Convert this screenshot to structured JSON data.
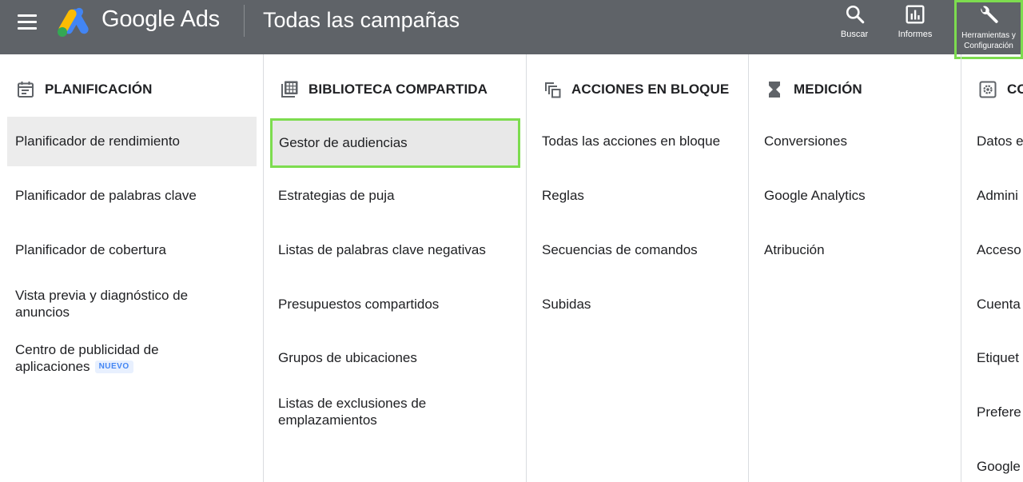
{
  "header": {
    "brand": "Google Ads",
    "page_title": "Todas las campañas",
    "tools": [
      {
        "label": "Buscar",
        "icon": "search-icon"
      },
      {
        "label": "Informes",
        "icon": "reports-icon"
      },
      {
        "label": "Herramientas y Configuración",
        "icon": "wrench-icon",
        "highlighted": true
      }
    ]
  },
  "columns": [
    {
      "title": "PLANIFICACIÓN",
      "icon": "calendar-icon",
      "items": [
        {
          "label": "Planificador de rendimiento",
          "selected": true
        },
        {
          "label": "Planificador de palabras clave"
        },
        {
          "label": "Planificador de cobertura"
        },
        {
          "label": "Vista previa y diagnóstico de anuncios"
        },
        {
          "label": "Centro de publicidad de aplicaciones",
          "badge": "NUEVO"
        }
      ]
    },
    {
      "title": "BIBLIOTECA COMPARTIDA",
      "icon": "library-grid-icon",
      "items": [
        {
          "label": "Gestor de audiencias",
          "highlighted": true
        },
        {
          "label": "Estrategias de puja"
        },
        {
          "label": "Listas de palabras clave negativas"
        },
        {
          "label": "Presupuestos compartidos"
        },
        {
          "label": "Grupos de ubicaciones"
        },
        {
          "label": "Listas de exclusiones de emplazamientos"
        }
      ]
    },
    {
      "title": "ACCIONES EN BLOQUE",
      "icon": "copy-stack-icon",
      "items": [
        {
          "label": "Todas las acciones en bloque"
        },
        {
          "label": "Reglas"
        },
        {
          "label": "Secuencias de comandos"
        },
        {
          "label": "Subidas"
        }
      ]
    },
    {
      "title": "MEDICIÓN",
      "icon": "hourglass-icon",
      "items": [
        {
          "label": "Conversiones"
        },
        {
          "label": "Google Analytics"
        },
        {
          "label": "Atribución"
        }
      ]
    },
    {
      "title": "CO",
      "icon": "gear-box-icon",
      "items": [
        {
          "label": "Datos e"
        },
        {
          "label": "Admini"
        },
        {
          "label": "Acceso"
        },
        {
          "label": "Cuenta"
        },
        {
          "label": "Etiquet"
        },
        {
          "label": "Prefere"
        },
        {
          "label": "Google"
        }
      ]
    }
  ],
  "colors": {
    "topbar": "#5f6368",
    "highlight_border": "#7ddc4f",
    "selected_bg": "#ececec",
    "badge_text": "#4285f4",
    "badge_bg": "#e8f0fe"
  }
}
